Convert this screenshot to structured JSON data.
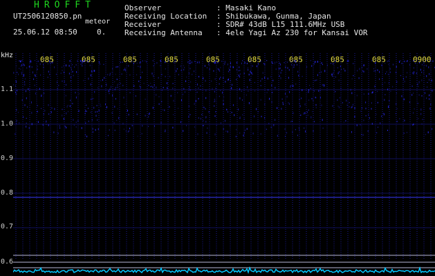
{
  "header": {
    "app_title": "HROFFT",
    "file_name": "UT2506120850.pn",
    "mode": "meteor",
    "datetime": "25.06.12 08:50",
    "count": "0."
  },
  "info": [
    {
      "label": "Observer",
      "value": ": Masaki Kano"
    },
    {
      "label": "Receiving Location",
      "value": ": Shibukawa, Gunma, Japan"
    },
    {
      "label": "Receiver",
      "value": ": SDR# 43dB L15 111.6MHz USB"
    },
    {
      "label": "Receiving Antenna",
      "value": ": 4ele Yagi Az 230 for Kansai VOR"
    }
  ],
  "axis": {
    "unit": "kHz",
    "y_ticks": [
      "1.1",
      "1.0",
      "0.9",
      "0.8",
      "0.7",
      "0.6"
    ],
    "x_ticks": [
      "085",
      "085",
      "085",
      "085",
      "085",
      "085",
      "085",
      "085",
      "085",
      "0900"
    ]
  },
  "colors": {
    "background": "#000000",
    "grid": "#1a1a9a",
    "signal": "#2a2aff",
    "baseline": "#c0c0e0",
    "power": "#00c8ff",
    "tick_label": "#e8e040",
    "title": "#1fd61f"
  }
}
